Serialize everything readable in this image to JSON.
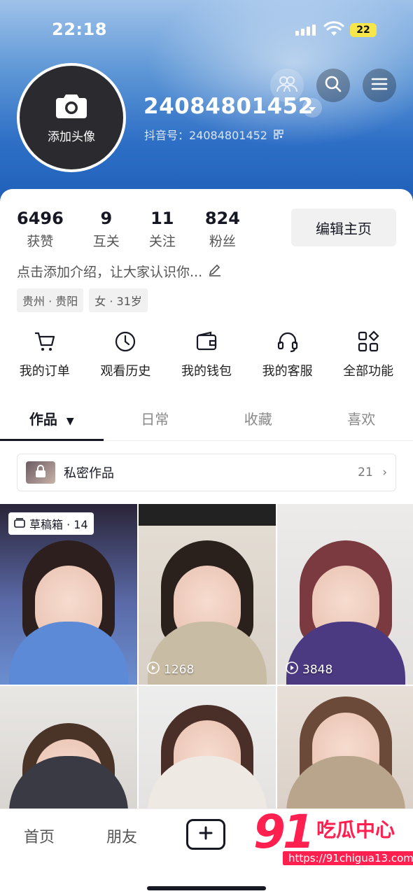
{
  "status": {
    "time": "22:18",
    "battery": "22"
  },
  "profile": {
    "avatar_label": "添加头像",
    "username": "24084801452",
    "douyin_id": "抖音号：24084801452",
    "bio_placeholder": "点击添加介绍，让大家认识你...",
    "tags": [
      "贵州 · 贵阳",
      "女 · 31岁"
    ]
  },
  "stats": [
    {
      "value": "6496",
      "label": "获赞"
    },
    {
      "value": "9",
      "label": "互关"
    },
    {
      "value": "11",
      "label": "关注"
    },
    {
      "value": "824",
      "label": "粉丝"
    }
  ],
  "edit_button": "编辑主页",
  "shortcuts": [
    {
      "label": "我的订单",
      "icon": "cart-icon"
    },
    {
      "label": "观看历史",
      "icon": "clock-icon"
    },
    {
      "label": "我的钱包",
      "icon": "wallet-icon"
    },
    {
      "label": "我的客服",
      "icon": "headset-icon"
    },
    {
      "label": "全部功能",
      "icon": "grid-icon"
    }
  ],
  "tabs": [
    "作品",
    "日常",
    "收藏",
    "喜欢"
  ],
  "private": {
    "label": "私密作品",
    "count": "21"
  },
  "videos": [
    {
      "badge": "草稿箱 · 14",
      "plays": ""
    },
    {
      "badge": "",
      "plays": "1268"
    },
    {
      "badge": "",
      "plays": "3848"
    },
    {
      "badge": "",
      "plays": ""
    },
    {
      "badge": "",
      "plays": ""
    },
    {
      "badge": "",
      "plays": ""
    }
  ],
  "nav": {
    "home": "首页",
    "friends": "朋友"
  },
  "watermark": {
    "brand": "91",
    "name": "吃瓜中心",
    "url": "https://91chigua13.com"
  },
  "colors": {
    "accent": "#ff2050",
    "header": "#2e6fc6"
  }
}
